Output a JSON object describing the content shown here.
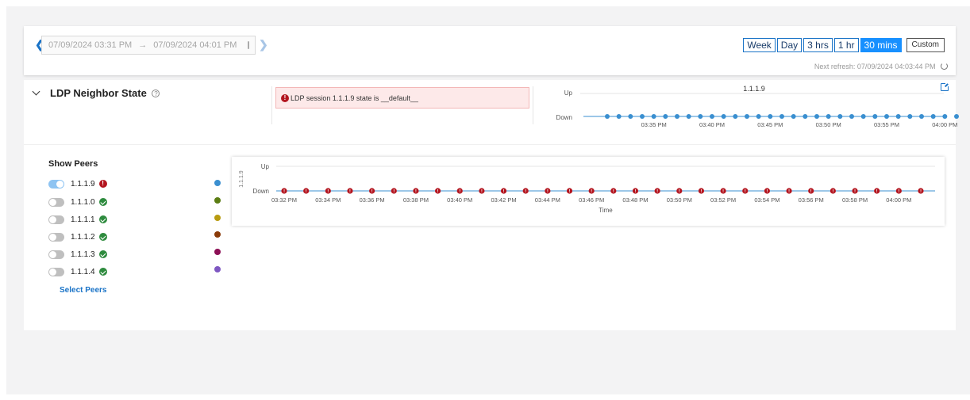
{
  "toolbar": {
    "range_start": "07/09/2024 03:31 PM",
    "range_arrow": "→",
    "range_end": "07/09/2024 04:01 PM",
    "buttons": [
      {
        "label": "Week",
        "active": false
      },
      {
        "label": "Day",
        "active": false
      },
      {
        "label": "3 hrs",
        "active": false
      },
      {
        "label": "1 hr",
        "active": false
      },
      {
        "label": "30 mins",
        "active": true
      }
    ],
    "custom_label": "Custom",
    "next_refresh": "Next refresh: 07/09/2024 04:03:44 PM"
  },
  "section": {
    "title": "LDP Neighbor State",
    "alert_text": "LDP session 1.1.1.9 state is __default__"
  },
  "mini_chart": {
    "series_name": "1.1.1.9",
    "y_categories": [
      "Up",
      "Down"
    ],
    "x_ticks": [
      "03:35 PM",
      "03:40 PM",
      "03:45 PM",
      "03:50 PM",
      "03:55 PM",
      "04:00 PM"
    ],
    "point_count": 31,
    "state": "Down",
    "color": "#3a8fd0"
  },
  "peers": {
    "title": "Show Peers",
    "select_label": "Select Peers",
    "items": [
      {
        "label": "1.1.1.9",
        "status": "error",
        "enabled": true,
        "color": "#3a8fd0"
      },
      {
        "label": "1.1.1.0",
        "status": "ok",
        "enabled": false,
        "color": "#5b7d13"
      },
      {
        "label": "1.1.1.1",
        "status": "ok",
        "enabled": false,
        "color": "#b89b10"
      },
      {
        "label": "1.1.1.2",
        "status": "ok",
        "enabled": false,
        "color": "#8a3b09"
      },
      {
        "label": "1.1.1.3",
        "status": "ok",
        "enabled": false,
        "color": "#8c0f55"
      },
      {
        "label": "1.1.1.4",
        "status": "ok",
        "enabled": false,
        "color": "#7e57c2"
      }
    ]
  },
  "chart_data": {
    "type": "scatter",
    "title": "",
    "xlabel": "Time",
    "ylabel": "1.1.1.9",
    "y_categories": [
      "Up",
      "Down"
    ],
    "x_ticks": [
      "03:32 PM",
      "03:34 PM",
      "03:36 PM",
      "03:38 PM",
      "03:40 PM",
      "03:42 PM",
      "03:44 PM",
      "03:46 PM",
      "03:48 PM",
      "03:50 PM",
      "03:52 PM",
      "03:54 PM",
      "03:56 PM",
      "03:58 PM",
      "04:00 PM"
    ],
    "series": [
      {
        "name": "1.1.1.9",
        "x": [
          "03:32 PM",
          "03:33 PM",
          "03:34 PM",
          "03:35 PM",
          "03:36 PM",
          "03:37 PM",
          "03:38 PM",
          "03:39 PM",
          "03:40 PM",
          "03:41 PM",
          "03:42 PM",
          "03:43 PM",
          "03:44 PM",
          "03:45 PM",
          "03:46 PM",
          "03:47 PM",
          "03:48 PM",
          "03:49 PM",
          "03:50 PM",
          "03:51 PM",
          "03:52 PM",
          "03:53 PM",
          "03:54 PM",
          "03:55 PM",
          "03:56 PM",
          "03:57 PM",
          "03:58 PM",
          "03:59 PM",
          "04:00 PM",
          "04:01 PM"
        ],
        "values": [
          "Down",
          "Down",
          "Down",
          "Down",
          "Down",
          "Down",
          "Down",
          "Down",
          "Down",
          "Down",
          "Down",
          "Down",
          "Down",
          "Down",
          "Down",
          "Down",
          "Down",
          "Down",
          "Down",
          "Down",
          "Down",
          "Down",
          "Down",
          "Down",
          "Down",
          "Down",
          "Down",
          "Down",
          "Down",
          "Down"
        ]
      }
    ],
    "grid": true,
    "marker_color": "#b3151f",
    "line_color": "#3a8fd0"
  }
}
